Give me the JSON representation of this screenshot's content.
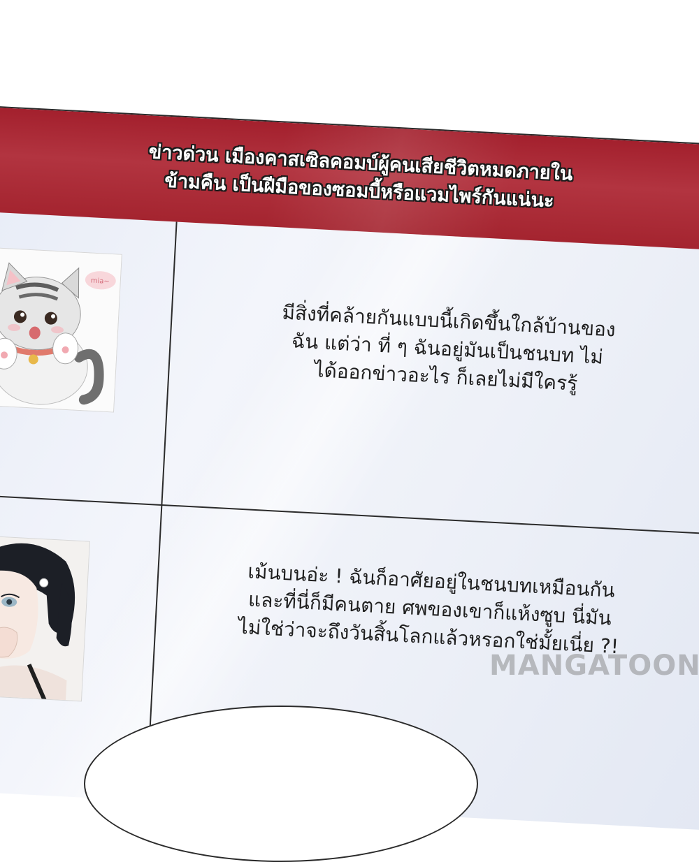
{
  "headline": {
    "line1": "ข่าวด่วน เมืองคาสเซิลคอมบ์ผู้คนเสียชีวิตหมดภายใน",
    "line2": "ข้ามคืน เป็นฝีมือของซอมบี้หรือแวมไพร์กันแน่นะ"
  },
  "message1": {
    "line1": "มีสิ่งที่คล้ายกันแบบนี้เกิดขึ้นใกล้บ้านของ",
    "line2": "ฉัน แต่ว่า ที่ ๆ ฉันอยู่มันเป็นชนบท ไม่",
    "line3": "ได้ออกข่าวอะไร ก็เลยไม่มีใครรู้"
  },
  "message2": {
    "line1": "เม้นบนอ่ะ ! ฉันก็อาศัยอยู่ในชนบทเหมือนกัน",
    "line2": "และที่นี่ก็มีคนตาย ศพของเขาก็แห้งซูบ นี่มัน",
    "line3": "ไม่ใช่ว่าจะถึงวันสิ้นโลกแล้วหรอกใช่มั้ยเนี่ย ?!"
  },
  "cat_sticker": {
    "speech": "mia~"
  },
  "watermark": "MANGATOON",
  "colors": {
    "banner": "#a3202d",
    "board": "#eef1f8",
    "text": "#1f1f1f"
  }
}
